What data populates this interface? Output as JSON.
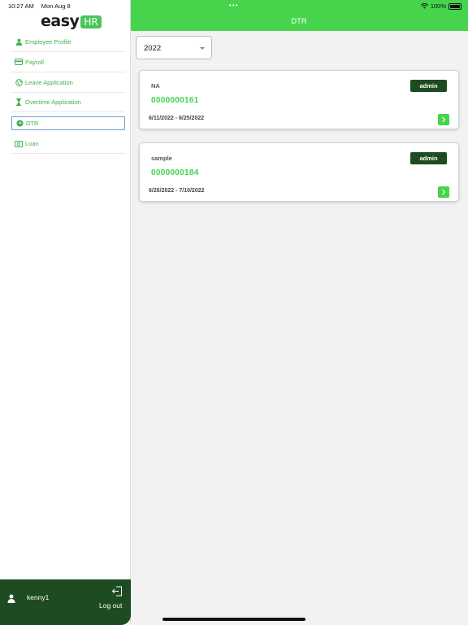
{
  "status_bar": {
    "time": "10:27 AM",
    "date": "Mon Aug 8",
    "battery": "100%"
  },
  "sidebar": {
    "logo": {
      "easy": "easy",
      "hr": "HR"
    },
    "items": [
      {
        "label": "Employee Profile",
        "icon": "person-icon"
      },
      {
        "label": "Payroll",
        "icon": "card-icon"
      },
      {
        "label": "Leave Application",
        "icon": "globe-icon"
      },
      {
        "label": "Overtime Application",
        "icon": "hourglass-icon"
      },
      {
        "label": "DTR",
        "icon": "clock-icon",
        "active": true
      },
      {
        "label": "Loan",
        "icon": "money-icon"
      }
    ],
    "user": {
      "name": "kenny1",
      "logout_label": "Log out"
    }
  },
  "header": {
    "title": "DTR"
  },
  "filter": {
    "year": "2022"
  },
  "records": [
    {
      "name": "NA",
      "badge": "admin",
      "id": "0000000161",
      "dates": "6/11/2022 - 6/25/2022"
    },
    {
      "name": "sample",
      "badge": "admin",
      "id": "0000000184",
      "dates": "6/26/2022 - 7/10/2022"
    }
  ],
  "colors": {
    "accent": "#45d44c",
    "dark_green": "#1e4c22",
    "menu_text": "#3eb24d"
  }
}
